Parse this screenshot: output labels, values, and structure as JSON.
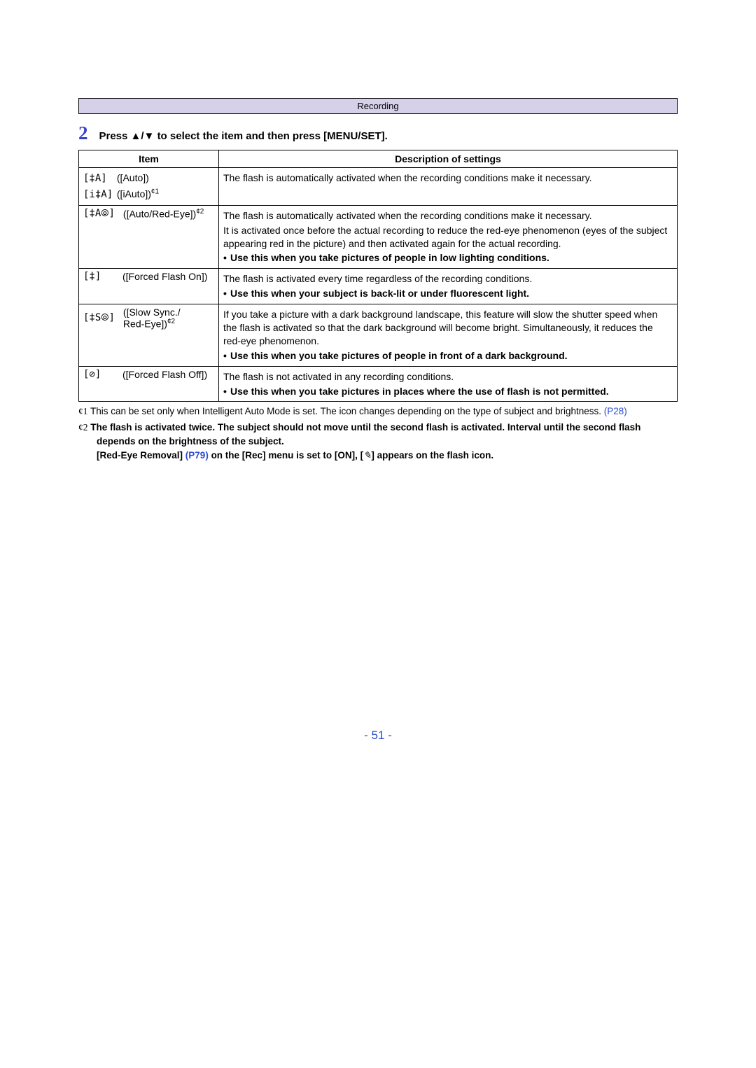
{
  "section_band": "Recording",
  "step": {
    "number": "2",
    "text": "Press ▲/▼ to select the item and then press [MENU/SET]."
  },
  "table": {
    "head": {
      "item": "Item",
      "desc": "Description of settings"
    },
    "rows": {
      "auto": {
        "icon1": "[‡A]",
        "label1": "([Auto])",
        "icon2": "[i‡A]",
        "label2_pre": "([iAuto])",
        "label2_sup": "¢1",
        "desc_p1": "The flash is automatically activated when the recording conditions make it necessary."
      },
      "autoRedEye": {
        "icon": "[‡A⦾]",
        "label_pre": "([Auto/Red-Eye])",
        "label_sup": "¢2",
        "desc_p1": "The flash is automatically activated when the recording conditions make it necessary.",
        "desc_p2": "It is activated once before the actual recording to reduce the red-eye phenomenon (eyes of the subject appearing red in the picture) and then activated again for the actual recording.",
        "desc_b1": "Use this when you take pictures of people in low lighting conditions."
      },
      "forcedOn": {
        "icon": "[‡]",
        "label": "([Forced Flash On])",
        "desc_p1": "The flash is activated every time regardless of the recording conditions.",
        "desc_b1": "Use this when your subject is back-lit or under fluorescent light."
      },
      "slow": {
        "icon": "[‡S⦾]",
        "label_l1": "([Slow Sync./",
        "label_l2_pre": "Red-Eye])",
        "label_l2_sup": "¢2",
        "desc_p1": "If you take a picture with a dark background landscape, this feature will slow the shutter speed when the flash is activated so that the dark background will become bright. Simultaneously, it reduces the red-eye phenomenon.",
        "desc_b1": "Use this when you take pictures of people in front of a dark background."
      },
      "forcedOff": {
        "icon": "[⊘]",
        "label": "([Forced Flash Off])",
        "desc_p1": "The flash is not activated in any recording conditions.",
        "desc_b1": "Use this when you take pictures in places where the use of flash is not permitted."
      }
    }
  },
  "footnotes": {
    "f1_star": "¢1",
    "f1_text_a": " This can be set only when Intelligent Auto Mode is set. The icon changes depending on the type of subject and brightness. ",
    "f1_link": "(P28)",
    "f2_star": "¢2",
    "f2_text_a": " The flash is activated twice. The subject should not move until the second flash is activated. Interval until the second flash depends on the brightness of the subject.",
    "f2_text_b1": "[Red-Eye Removal] ",
    "f2_link": "(P79)",
    "f2_text_b2": " on the [Rec] menu is set to [ON], [",
    "f2_icon": "✎",
    "f2_text_b3": "] appears on the flash icon."
  },
  "page_number": "- 51 -"
}
